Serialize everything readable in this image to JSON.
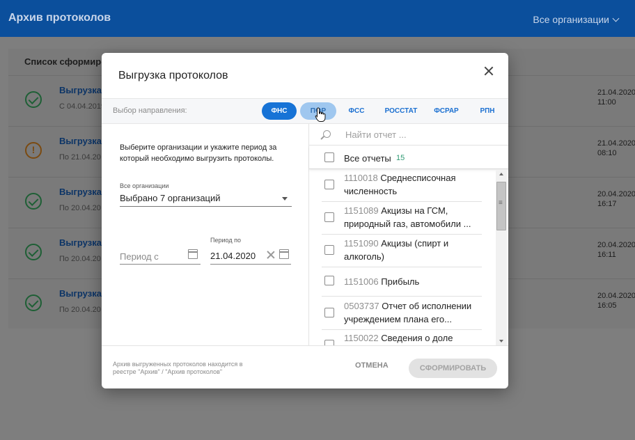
{
  "app": {
    "title": "Архив протоколов",
    "org_selector": "Все организации"
  },
  "background": {
    "list_title": "Список сформиро",
    "rows": [
      {
        "status": "success",
        "title": "Выгрузка",
        "subtitle": "С 04.04.2019",
        "date": "21.04.2020",
        "time": "11:00"
      },
      {
        "status": "warning",
        "title": "Выгрузка",
        "subtitle": "По 21.04.20",
        "date": "21.04.2020",
        "time": "08:10"
      },
      {
        "status": "success",
        "title": "Выгрузка",
        "subtitle": "По 20.04.20",
        "date": "20.04.2020",
        "time": "16:17"
      },
      {
        "status": "success",
        "title": "Выгрузка",
        "subtitle": "По 20.04.20",
        "date": "20.04.2020",
        "time": "16:11"
      },
      {
        "status": "success",
        "title": "Выгрузка",
        "subtitle": "По 20.04.20",
        "date": "20.04.2020",
        "time": "16:05"
      }
    ]
  },
  "modal": {
    "title": "Выгрузка протоколов",
    "direction_label": "Выбор направления:",
    "directions": [
      {
        "label": "ФНС",
        "state": "active"
      },
      {
        "label": "ПФР",
        "state": "hover"
      },
      {
        "label": "ФСС",
        "state": "normal"
      },
      {
        "label": "РОССТАТ",
        "state": "normal"
      },
      {
        "label": "ФСРАР",
        "state": "normal"
      },
      {
        "label": "РПН",
        "state": "normal"
      }
    ],
    "instructions": "Выберите организации и укажите период за который необходимо выгрузить протоколы.",
    "org_label": "Все организации",
    "org_value": "Выбрано 7 организаций",
    "period_from_placeholder": "Период с",
    "period_to_label": "Период по",
    "period_to_value": "21.04.2020",
    "search_placeholder": "Найти отчет ...",
    "all_reports_label": "Все отчеты",
    "all_reports_count": "15",
    "reports": [
      {
        "code": "1110018",
        "name": "Среднесписочная численность"
      },
      {
        "code": "1151089",
        "name": "Акцизы на ГСМ, природный газ, автомобили ..."
      },
      {
        "code": "1151090",
        "name": "Акцизы (спирт и алкоголь)"
      },
      {
        "code": "1151006",
        "name": "Прибыль"
      },
      {
        "code": "0503737",
        "name": "Отчет об исполнении учреждением плана его..."
      },
      {
        "code": "1150022",
        "name": "Сведения о доле"
      }
    ],
    "footer_note": "Архив выгруженных протоколов находится в реестре \"Архив\" / \"Архив протоколов\"",
    "cancel_label": "ОТМЕНА",
    "generate_label": "СФОРМИРОВАТЬ"
  }
}
